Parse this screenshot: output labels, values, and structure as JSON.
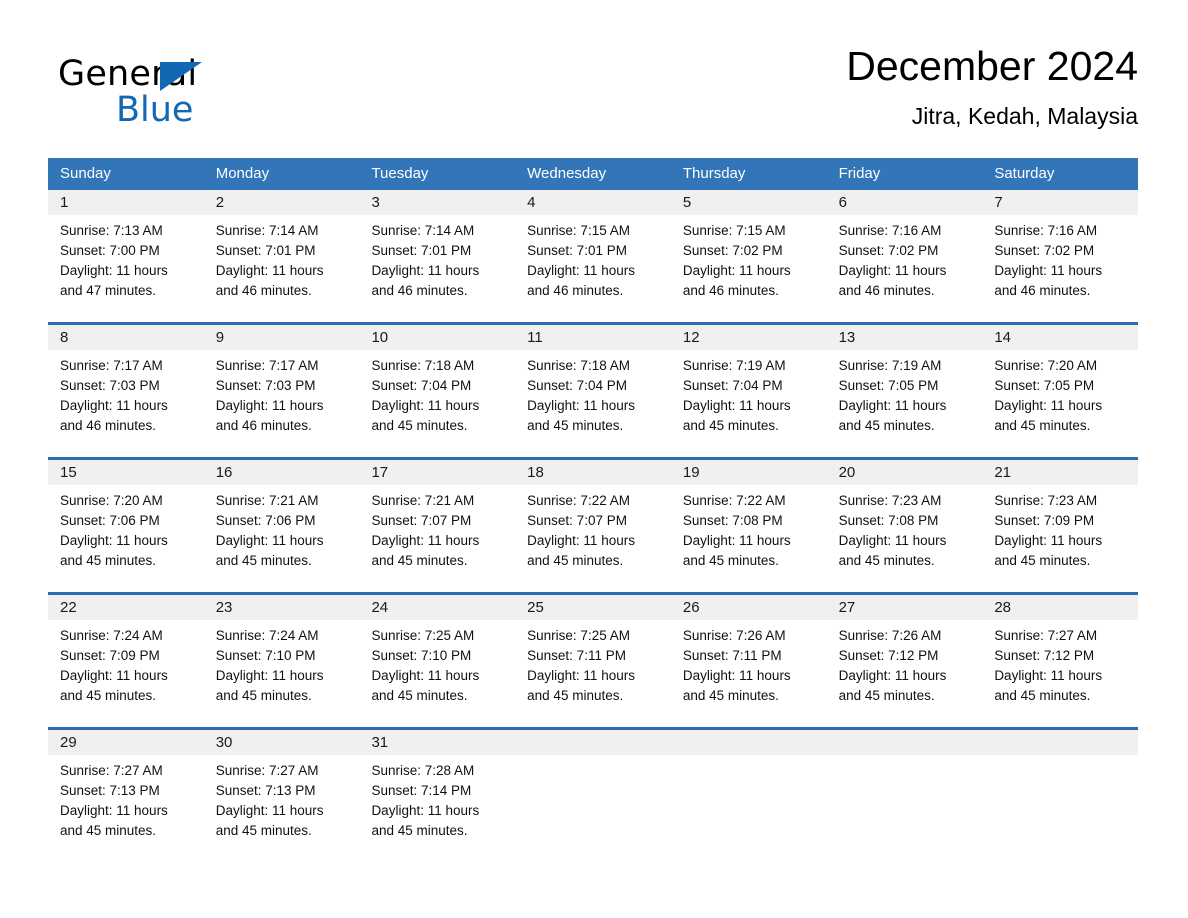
{
  "brand": {
    "name_top": "General",
    "name_bottom": "Blue",
    "triangle_color": "#1268b3"
  },
  "header": {
    "title": "December 2024",
    "location": "Jitra, Kedah, Malaysia"
  },
  "theme": {
    "header_bg": "#3275b8",
    "row_rule": "#2a6cb0",
    "date_band": "#f0f0f0"
  },
  "calendar": {
    "weekdays": [
      "Sunday",
      "Monday",
      "Tuesday",
      "Wednesday",
      "Thursday",
      "Friday",
      "Saturday"
    ],
    "weeks": [
      [
        {
          "date": "1",
          "sunrise": "Sunrise: 7:13 AM",
          "sunset": "Sunset: 7:00 PM",
          "daylight_1": "Daylight: 11 hours",
          "daylight_2": "and 47 minutes."
        },
        {
          "date": "2",
          "sunrise": "Sunrise: 7:14 AM",
          "sunset": "Sunset: 7:01 PM",
          "daylight_1": "Daylight: 11 hours",
          "daylight_2": "and 46 minutes."
        },
        {
          "date": "3",
          "sunrise": "Sunrise: 7:14 AM",
          "sunset": "Sunset: 7:01 PM",
          "daylight_1": "Daylight: 11 hours",
          "daylight_2": "and 46 minutes."
        },
        {
          "date": "4",
          "sunrise": "Sunrise: 7:15 AM",
          "sunset": "Sunset: 7:01 PM",
          "daylight_1": "Daylight: 11 hours",
          "daylight_2": "and 46 minutes."
        },
        {
          "date": "5",
          "sunrise": "Sunrise: 7:15 AM",
          "sunset": "Sunset: 7:02 PM",
          "daylight_1": "Daylight: 11 hours",
          "daylight_2": "and 46 minutes."
        },
        {
          "date": "6",
          "sunrise": "Sunrise: 7:16 AM",
          "sunset": "Sunset: 7:02 PM",
          "daylight_1": "Daylight: 11 hours",
          "daylight_2": "and 46 minutes."
        },
        {
          "date": "7",
          "sunrise": "Sunrise: 7:16 AM",
          "sunset": "Sunset: 7:02 PM",
          "daylight_1": "Daylight: 11 hours",
          "daylight_2": "and 46 minutes."
        }
      ],
      [
        {
          "date": "8",
          "sunrise": "Sunrise: 7:17 AM",
          "sunset": "Sunset: 7:03 PM",
          "daylight_1": "Daylight: 11 hours",
          "daylight_2": "and 46 minutes."
        },
        {
          "date": "9",
          "sunrise": "Sunrise: 7:17 AM",
          "sunset": "Sunset: 7:03 PM",
          "daylight_1": "Daylight: 11 hours",
          "daylight_2": "and 46 minutes."
        },
        {
          "date": "10",
          "sunrise": "Sunrise: 7:18 AM",
          "sunset": "Sunset: 7:04 PM",
          "daylight_1": "Daylight: 11 hours",
          "daylight_2": "and 45 minutes."
        },
        {
          "date": "11",
          "sunrise": "Sunrise: 7:18 AM",
          "sunset": "Sunset: 7:04 PM",
          "daylight_1": "Daylight: 11 hours",
          "daylight_2": "and 45 minutes."
        },
        {
          "date": "12",
          "sunrise": "Sunrise: 7:19 AM",
          "sunset": "Sunset: 7:04 PM",
          "daylight_1": "Daylight: 11 hours",
          "daylight_2": "and 45 minutes."
        },
        {
          "date": "13",
          "sunrise": "Sunrise: 7:19 AM",
          "sunset": "Sunset: 7:05 PM",
          "daylight_1": "Daylight: 11 hours",
          "daylight_2": "and 45 minutes."
        },
        {
          "date": "14",
          "sunrise": "Sunrise: 7:20 AM",
          "sunset": "Sunset: 7:05 PM",
          "daylight_1": "Daylight: 11 hours",
          "daylight_2": "and 45 minutes."
        }
      ],
      [
        {
          "date": "15",
          "sunrise": "Sunrise: 7:20 AM",
          "sunset": "Sunset: 7:06 PM",
          "daylight_1": "Daylight: 11 hours",
          "daylight_2": "and 45 minutes."
        },
        {
          "date": "16",
          "sunrise": "Sunrise: 7:21 AM",
          "sunset": "Sunset: 7:06 PM",
          "daylight_1": "Daylight: 11 hours",
          "daylight_2": "and 45 minutes."
        },
        {
          "date": "17",
          "sunrise": "Sunrise: 7:21 AM",
          "sunset": "Sunset: 7:07 PM",
          "daylight_1": "Daylight: 11 hours",
          "daylight_2": "and 45 minutes."
        },
        {
          "date": "18",
          "sunrise": "Sunrise: 7:22 AM",
          "sunset": "Sunset: 7:07 PM",
          "daylight_1": "Daylight: 11 hours",
          "daylight_2": "and 45 minutes."
        },
        {
          "date": "19",
          "sunrise": "Sunrise: 7:22 AM",
          "sunset": "Sunset: 7:08 PM",
          "daylight_1": "Daylight: 11 hours",
          "daylight_2": "and 45 minutes."
        },
        {
          "date": "20",
          "sunrise": "Sunrise: 7:23 AM",
          "sunset": "Sunset: 7:08 PM",
          "daylight_1": "Daylight: 11 hours",
          "daylight_2": "and 45 minutes."
        },
        {
          "date": "21",
          "sunrise": "Sunrise: 7:23 AM",
          "sunset": "Sunset: 7:09 PM",
          "daylight_1": "Daylight: 11 hours",
          "daylight_2": "and 45 minutes."
        }
      ],
      [
        {
          "date": "22",
          "sunrise": "Sunrise: 7:24 AM",
          "sunset": "Sunset: 7:09 PM",
          "daylight_1": "Daylight: 11 hours",
          "daylight_2": "and 45 minutes."
        },
        {
          "date": "23",
          "sunrise": "Sunrise: 7:24 AM",
          "sunset": "Sunset: 7:10 PM",
          "daylight_1": "Daylight: 11 hours",
          "daylight_2": "and 45 minutes."
        },
        {
          "date": "24",
          "sunrise": "Sunrise: 7:25 AM",
          "sunset": "Sunset: 7:10 PM",
          "daylight_1": "Daylight: 11 hours",
          "daylight_2": "and 45 minutes."
        },
        {
          "date": "25",
          "sunrise": "Sunrise: 7:25 AM",
          "sunset": "Sunset: 7:11 PM",
          "daylight_1": "Daylight: 11 hours",
          "daylight_2": "and 45 minutes."
        },
        {
          "date": "26",
          "sunrise": "Sunrise: 7:26 AM",
          "sunset": "Sunset: 7:11 PM",
          "daylight_1": "Daylight: 11 hours",
          "daylight_2": "and 45 minutes."
        },
        {
          "date": "27",
          "sunrise": "Sunrise: 7:26 AM",
          "sunset": "Sunset: 7:12 PM",
          "daylight_1": "Daylight: 11 hours",
          "daylight_2": "and 45 minutes."
        },
        {
          "date": "28",
          "sunrise": "Sunrise: 7:27 AM",
          "sunset": "Sunset: 7:12 PM",
          "daylight_1": "Daylight: 11 hours",
          "daylight_2": "and 45 minutes."
        }
      ],
      [
        {
          "date": "29",
          "sunrise": "Sunrise: 7:27 AM",
          "sunset": "Sunset: 7:13 PM",
          "daylight_1": "Daylight: 11 hours",
          "daylight_2": "and 45 minutes."
        },
        {
          "date": "30",
          "sunrise": "Sunrise: 7:27 AM",
          "sunset": "Sunset: 7:13 PM",
          "daylight_1": "Daylight: 11 hours",
          "daylight_2": "and 45 minutes."
        },
        {
          "date": "31",
          "sunrise": "Sunrise: 7:28 AM",
          "sunset": "Sunset: 7:14 PM",
          "daylight_1": "Daylight: 11 hours",
          "daylight_2": "and 45 minutes."
        },
        {
          "date": "",
          "sunrise": "",
          "sunset": "",
          "daylight_1": "",
          "daylight_2": ""
        },
        {
          "date": "",
          "sunrise": "",
          "sunset": "",
          "daylight_1": "",
          "daylight_2": ""
        },
        {
          "date": "",
          "sunrise": "",
          "sunset": "",
          "daylight_1": "",
          "daylight_2": ""
        },
        {
          "date": "",
          "sunrise": "",
          "sunset": "",
          "daylight_1": "",
          "daylight_2": ""
        }
      ]
    ]
  }
}
